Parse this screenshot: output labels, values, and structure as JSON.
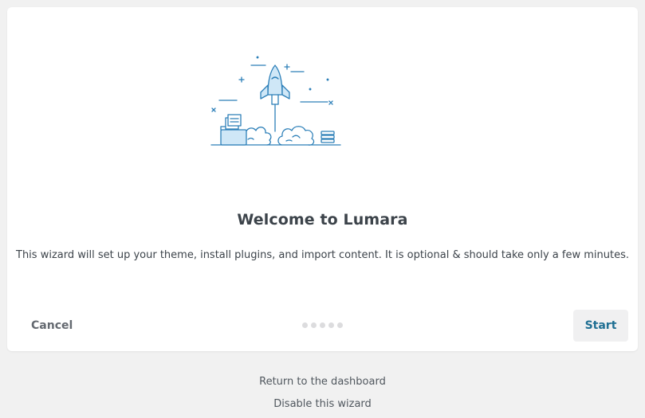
{
  "wizard": {
    "title": "Welcome to Lumara",
    "description": "This wizard will set up your theme, install plugins, and import content. It is optional & should take only a few minutes.",
    "illustration_icon": "rocket-launch-illustration",
    "cancel_label": "Cancel",
    "start_label": "Start",
    "steps_total": 5,
    "steps_current": 1
  },
  "footer": {
    "dashboard_link": "Return to the dashboard",
    "disable_link": "Disable this wizard"
  },
  "colors": {
    "accent": "#1f6f93",
    "illustration_stroke": "#2c7fb8",
    "illustration_fill": "#cfe7f7"
  }
}
